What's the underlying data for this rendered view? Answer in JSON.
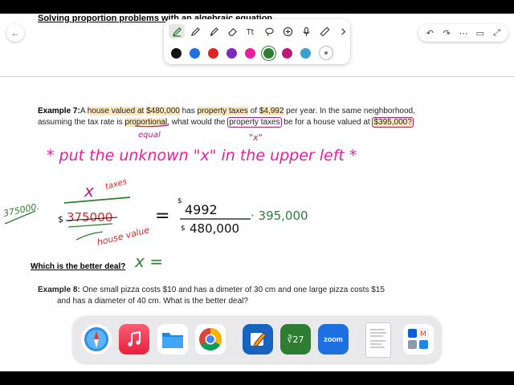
{
  "document": {
    "title": "Solving proportion problems with an algebraic equation"
  },
  "toolbar": {
    "tools": [
      "pen-icon",
      "pencil-icon",
      "highlighter-icon",
      "eraser-icon",
      "text-tool-icon",
      "lasso-icon",
      "add-icon",
      "microphone-icon",
      "ruler-icon",
      "chevron-right-icon"
    ],
    "colors": [
      "#111111",
      "#1e6fe0",
      "#e02424",
      "#7b2cbf",
      "#e91e9c",
      "#2e7d32",
      "#c2187d",
      "#3ca0d0"
    ],
    "selected_color": "#2e7d32"
  },
  "right_tools": [
    "undo-icon",
    "redo-icon",
    "more-icon",
    "comment-icon",
    "expand-icon"
  ],
  "example7": {
    "label": "Example 7:",
    "line1_parts": [
      "A ",
      "house valued at",
      " ",
      "$480,000",
      " has ",
      "property taxes",
      " of ",
      "$4,992",
      " per year. In the same neighborhood,"
    ],
    "line2_parts": [
      "assuming the tax rate is ",
      "proportional",
      ", what would the ",
      "property taxes",
      " be for a house valued at ",
      "$395,000?"
    ]
  },
  "section_heading": "Which is the better deal?",
  "example8": {
    "label": "Example 8:",
    "line1": " One small pizza costs $10 and has a dimeter of 30 cm and one large pizza costs $15",
    "line2": "and has a diameter of 40 cm. What is the better deal?"
  },
  "annotations": {
    "equal": "equal",
    "x_quote": "\"x\"",
    "instruction": "* put the unknown \"x\" in the upper left *",
    "crossed_value": "375000.",
    "numerator": "x",
    "numerator_label": "taxes",
    "dollar": "$",
    "denominator": "375000",
    "denominator_label": "house value",
    "equals_sign": "=",
    "rhs_numerator": "4992",
    "rhs_denominator": "480,000",
    "multiplier": "· 395,000",
    "answer": "x ="
  },
  "dock": {
    "apps": [
      "safari-icon",
      "music-icon",
      "files-icon",
      "chrome-icon",
      "goodnotes-icon",
      "calculator-icon",
      "zoom-icon",
      "document-thumbnail",
      "app-folder-icon"
    ],
    "calculator_label": "∛27",
    "zoom_label": "zoom"
  }
}
